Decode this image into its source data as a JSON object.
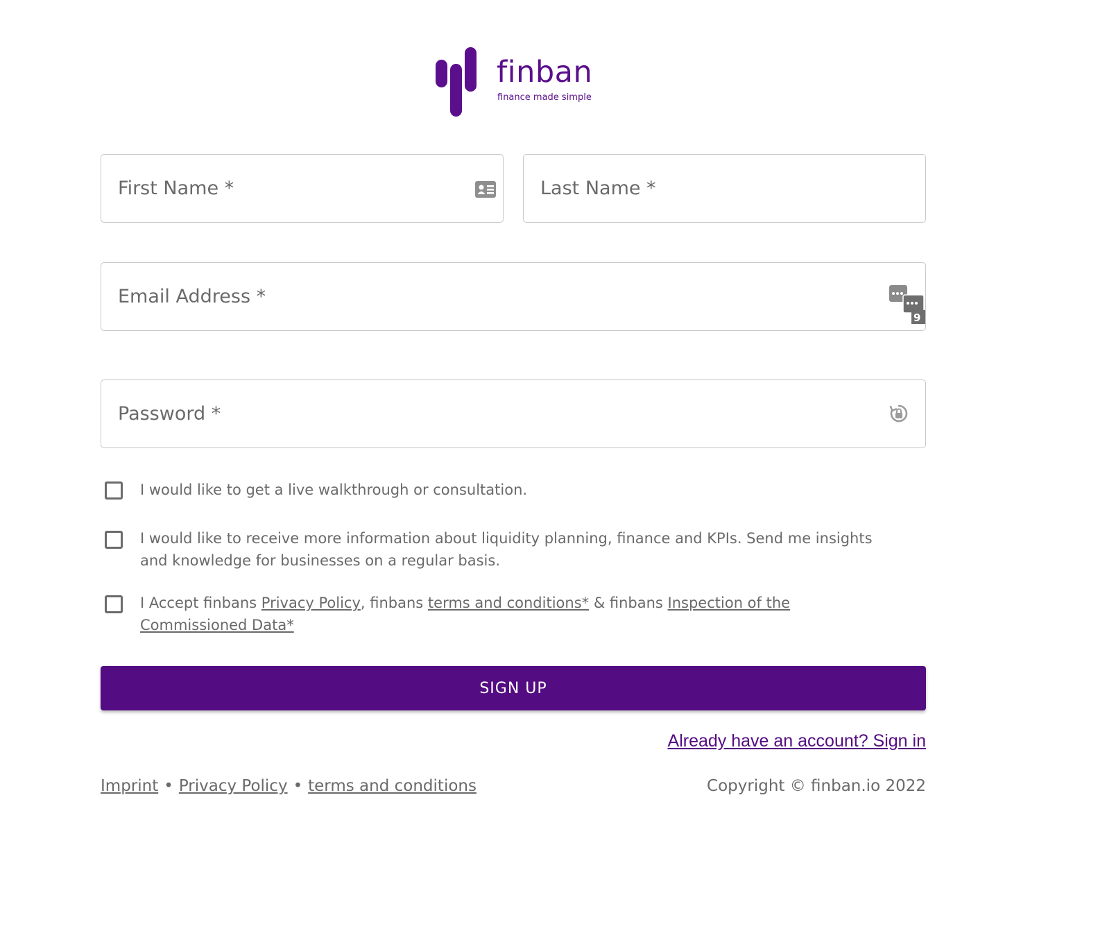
{
  "brand": {
    "name": "finban",
    "tagline": "finance made simple",
    "color": "#5b0f8c"
  },
  "form": {
    "first_name": {
      "label": "First Name *",
      "value": ""
    },
    "last_name": {
      "label": "Last Name *",
      "value": ""
    },
    "email": {
      "label": "Email Address *",
      "value": ""
    },
    "password": {
      "label": "Password *",
      "value": ""
    },
    "password_manager_badge": "9",
    "checkboxes": {
      "consultation": {
        "text": "I would like to get a live walkthrough or consultation.",
        "checked": false
      },
      "newsletter": {
        "text": "I would like to receive more information about liquidity planning, finance and KPIs. Send me insights and knowledge for businesses on a regular basis.",
        "checked": false
      },
      "accept": {
        "prefix": "I Accept finbans ",
        "privacy_link": "Privacy Policy",
        "mid1": ", finbans ",
        "terms_link": "terms and conditions*",
        "mid2": " & finbans ",
        "inspection_link": "Inspection of the Commissioned Data*",
        "checked": false
      }
    },
    "submit_label": "SIGN UP",
    "submit_color": "#540c82",
    "signin_link": "Already have an account? Sign in"
  },
  "footer": {
    "imprint": "Imprint",
    "separator": "•",
    "privacy": "Privacy Policy",
    "terms": "terms and conditions",
    "copyright": "Copyright © finban.io 2022"
  }
}
